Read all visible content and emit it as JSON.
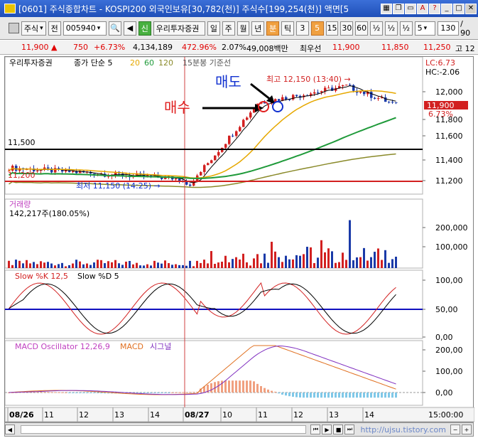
{
  "window": {
    "title": "[0601] 주식종합차트 - KOSPI200 외국인보유[30,782(천)] 주식수[199,254(천)] 액면[5"
  },
  "toolbar": {
    "market": "주식",
    "prefix": "전",
    "code": "005940",
    "sel_mark": "신",
    "company": "우리투자증권",
    "period_day": "일",
    "period_week": "주",
    "period_month": "월",
    "period_year": "년",
    "period_min": "분",
    "period_tick": "틱",
    "n3": "3",
    "n5": "5",
    "n15": "15",
    "n30": "30",
    "n60": "60",
    "half1": "½",
    "half2": "½",
    "half3": "½",
    "interval": "5",
    "count": "130",
    "total": "/ 90"
  },
  "infobar": {
    "price": "11,900 ▲",
    "change": "750",
    "change_pct": "+6.73%",
    "volume": "4,134,189",
    "volume_ratio": "472.96%",
    "turnover": "2.07%",
    "amount": "49,008백만",
    "label_best": "최우선",
    "ask": "11,900",
    "bid": "11,850",
    "low": "11,250",
    "high_label": "고 12"
  },
  "price_panel": {
    "legend_company": "우리투자증권",
    "legend_close": "종가 단순 5",
    "ma20": "20",
    "ma60": "60",
    "ma120": "120",
    "ma_title": "15분봉 기준선",
    "lc": "LC:6.73",
    "hc": "HC:-2.06",
    "current": "11,900",
    "current_pct": "6.73%",
    "high_note": "최고 12,150 (13:40) →",
    "low_note": "최저 11,150 (14:25) →",
    "sell_label": "매도",
    "buy_label": "매수",
    "line_label_1": "11,500",
    "line_label_2": "11,200",
    "ticks": [
      "12,000",
      "11,800",
      "11,600",
      "11,400",
      "11,200"
    ]
  },
  "volume_panel": {
    "title": "거래량",
    "value": "142,217주(180.05%)",
    "ticks": [
      "200,000",
      "100,000"
    ]
  },
  "stoch_panel": {
    "k_label": "Slow %K 12,5",
    "d_label": "Slow %D 5",
    "ticks": [
      "100,00",
      "50,00",
      "0,00"
    ]
  },
  "macd_panel": {
    "osc_label": "MACD Oscillator 12,26,9",
    "macd_label": "MACD",
    "signal_label": "시그널",
    "ticks": [
      "200,00",
      "100,00",
      "0,00"
    ]
  },
  "xaxis": {
    "labels": [
      "08/26",
      "11",
      "12",
      "13",
      "14",
      "08/27",
      "10",
      "11",
      "12",
      "13",
      "14"
    ],
    "time": "15:00:00"
  },
  "bottombar": {
    "watermark": "http://ujsu.tistory.com"
  },
  "colors": {
    "up": "#d22020",
    "down": "#1a3aa8",
    "ma5": "#000000",
    "ma20": "#e6a800",
    "ma60": "#1f9a3a",
    "ma120": "#8a8a2a",
    "annot_red": "#e02020",
    "annot_blue": "#1030d0"
  }
}
